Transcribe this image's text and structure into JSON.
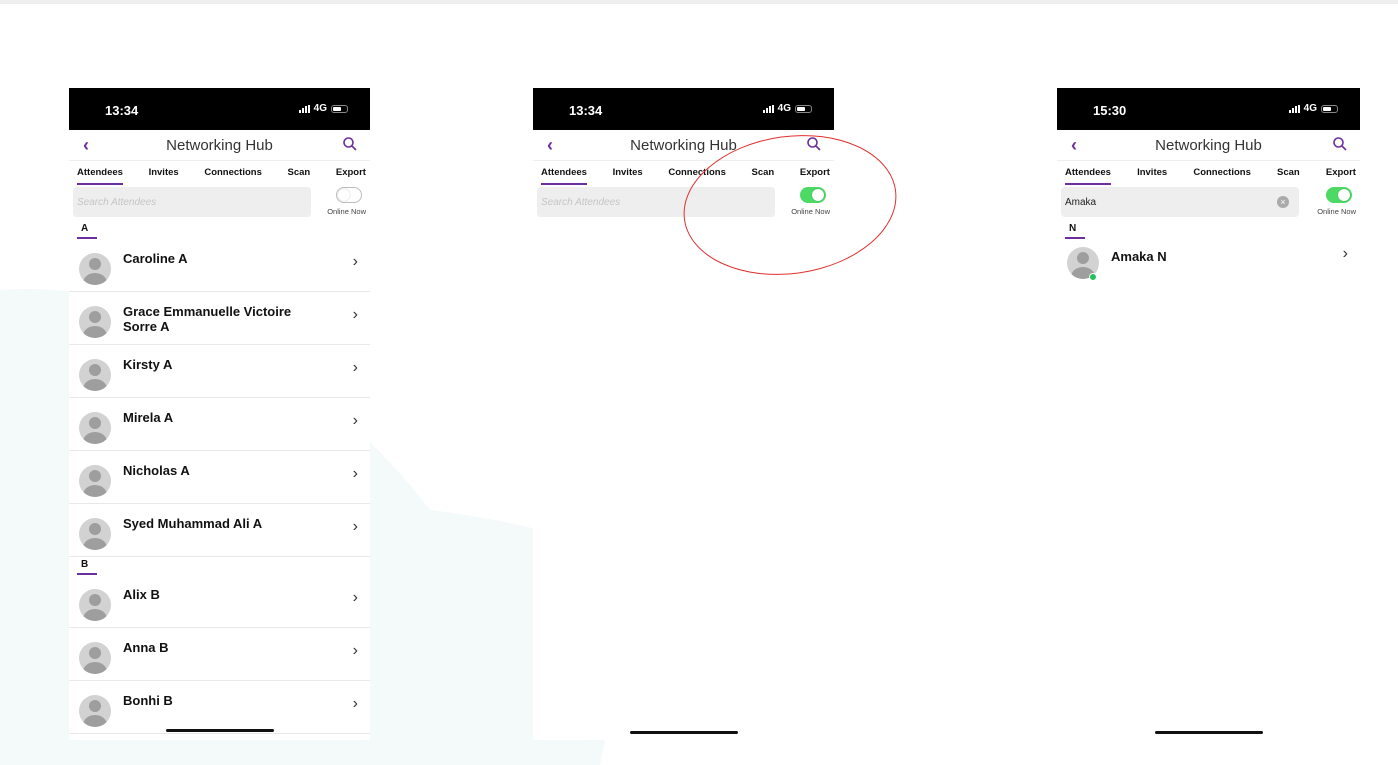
{
  "colors": {
    "accent": "#6b2fa0",
    "toggle_on": "#4cd964",
    "online": "#25c25a",
    "annotation": "#e03030"
  },
  "screens": [
    {
      "status": {
        "time": "13:34",
        "network": "4G"
      },
      "nav": {
        "back_icon": "chevron-left-icon",
        "title": "Networking Hub",
        "search_icon": "magnifier-icon"
      },
      "tabs": [
        {
          "label": "Attendees",
          "active": true
        },
        {
          "label": "Invites"
        },
        {
          "label": "Connections"
        },
        {
          "label": "Scan"
        },
        {
          "label": "Export"
        }
      ],
      "search": {
        "placeholder": "Search Attendees",
        "value": ""
      },
      "toggle": {
        "label": "Online Now",
        "on": false
      },
      "sections": [
        {
          "letter": "A",
          "items": [
            "Caroline A",
            "Grace Emmanuelle Victoire Sorre A",
            "Kirsty A",
            "Mirela A",
            "Nicholas A",
            "Syed Muhammad Ali A"
          ]
        },
        {
          "letter": "B",
          "items": [
            "Alix B",
            "Anna B",
            "Bonhi B"
          ]
        }
      ]
    },
    {
      "status": {
        "time": "13:34",
        "network": "4G"
      },
      "nav": {
        "back_icon": "chevron-left-icon",
        "title": "Networking Hub",
        "search_icon": "magnifier-icon"
      },
      "tabs": [
        {
          "label": "Attendees",
          "active": true
        },
        {
          "label": "Invites"
        },
        {
          "label": "Connections"
        },
        {
          "label": "Scan"
        },
        {
          "label": "Export"
        }
      ],
      "search": {
        "placeholder": "Search Attendees",
        "value": ""
      },
      "toggle": {
        "label": "Online Now",
        "on": true
      }
    },
    {
      "status": {
        "time": "15:30",
        "network": "4G"
      },
      "nav": {
        "back_icon": "chevron-left-icon",
        "title": "Networking Hub",
        "search_icon": "magnifier-icon"
      },
      "tabs": [
        {
          "label": "Attendees",
          "active": true
        },
        {
          "label": "Invites"
        },
        {
          "label": "Connections"
        },
        {
          "label": "Scan"
        },
        {
          "label": "Export"
        }
      ],
      "search": {
        "placeholder": "Search Attendees",
        "value": "Amaka"
      },
      "toggle": {
        "label": "Online Now",
        "on": true
      },
      "sections": [
        {
          "letter": "N",
          "items": [
            "Amaka N"
          ]
        }
      ]
    }
  ]
}
